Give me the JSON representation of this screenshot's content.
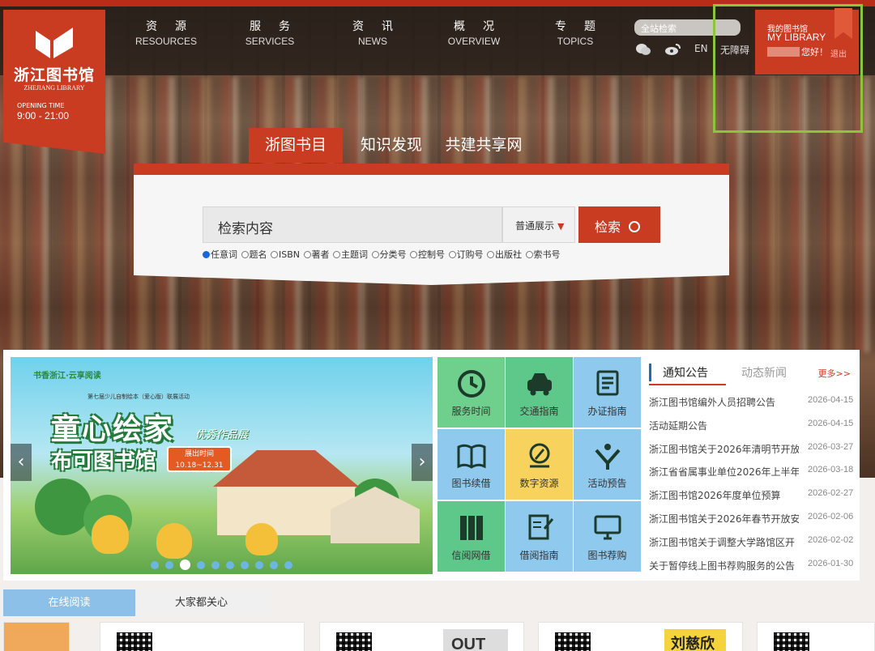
{
  "logo": {
    "name_cn": "浙江图书馆",
    "name_en": "ZHEJIANG LIBRARY",
    "opening_label": "OPENING TIME",
    "hours": "9:00 - 21:00"
  },
  "nav": [
    {
      "cn": "资源",
      "en": "RESOURCES"
    },
    {
      "cn": "服务",
      "en": "SERVICES"
    },
    {
      "cn": "资讯",
      "en": "NEWS"
    },
    {
      "cn": "概况",
      "en": "OVERVIEW"
    },
    {
      "cn": "专题",
      "en": "TOPICS"
    }
  ],
  "site_search": {
    "placeholder": "全站检索"
  },
  "tools": {
    "lang": "EN",
    "accessible": "无障碍"
  },
  "my_library": {
    "cn": "我的图书馆",
    "en": "MY LIBRARY",
    "hello": "您好！",
    "logout": "退出"
  },
  "search": {
    "tabs": [
      "浙图书目",
      "知识发现",
      "共建共享网"
    ],
    "placeholder": "检索内容",
    "display_mode": "普通展示",
    "button": "检索",
    "options": [
      "任意词",
      "题名",
      "ISBN",
      "著者",
      "主题词",
      "分类号",
      "控制号",
      "订购号",
      "出版社",
      "索书号"
    ]
  },
  "banner": {
    "brand": "书香浙江·云享阅读",
    "subtitle": "第七届少儿自制绘本（爱心版）联展活动",
    "title1": "童心绘家",
    "title2": "布可图书馆",
    "tag": "优秀作品展",
    "date_label": "展出时间",
    "date": "10.18~12.31",
    "prev": "‹",
    "next": "›"
  },
  "tiles": [
    {
      "label": "服务时间",
      "icon": "clock-icon",
      "bg": "#6fcf8d"
    },
    {
      "label": "交通指南",
      "icon": "car-icon",
      "bg": "#5ec88a"
    },
    {
      "label": "办证指南",
      "icon": "card-icon",
      "bg": "#8fc9ee"
    },
    {
      "label": "图书续借",
      "icon": "book-icon",
      "bg": "#8fc9ee"
    },
    {
      "label": "数字资源",
      "icon": "compass-icon",
      "bg": "#f7d35d"
    },
    {
      "label": "活动预告",
      "icon": "people-icon",
      "bg": "#8fc9ee"
    },
    {
      "label": "信阅网借",
      "icon": "books-icon",
      "bg": "#5ec88a"
    },
    {
      "label": "借阅指南",
      "icon": "pen-icon",
      "bg": "#8fc9ee"
    },
    {
      "label": "图书荐购",
      "icon": "computer-icon",
      "bg": "#8fc9ee"
    }
  ],
  "notice": {
    "tab1": "通知公告",
    "tab2": "动态新闻",
    "more": "更多>>",
    "items": [
      {
        "title": "浙江图书馆编外人员招聘公告",
        "date": "2026-04-15"
      },
      {
        "title": "活动延期公告",
        "date": "2026-04-15"
      },
      {
        "title": "浙江图书馆关于2026年清明节开放",
        "date": "2026-03-27"
      },
      {
        "title": "浙江省省属事业单位2026年上半年",
        "date": "2026-03-18"
      },
      {
        "title": "浙江图书馆2026年度单位预算",
        "date": "2026-02-27"
      },
      {
        "title": "浙江图书馆关于2026年春节开放安",
        "date": "2026-02-06"
      },
      {
        "title": "浙江图书馆关于调整大学路馆区开",
        "date": "2026-02-02"
      },
      {
        "title": "关于暂停线上图书荐购服务的公告",
        "date": "2026-01-30"
      }
    ]
  },
  "bottom_tabs": [
    "在线阅读",
    "大家都关心"
  ],
  "cards": [
    "OUT",
    "刘慈欣"
  ]
}
